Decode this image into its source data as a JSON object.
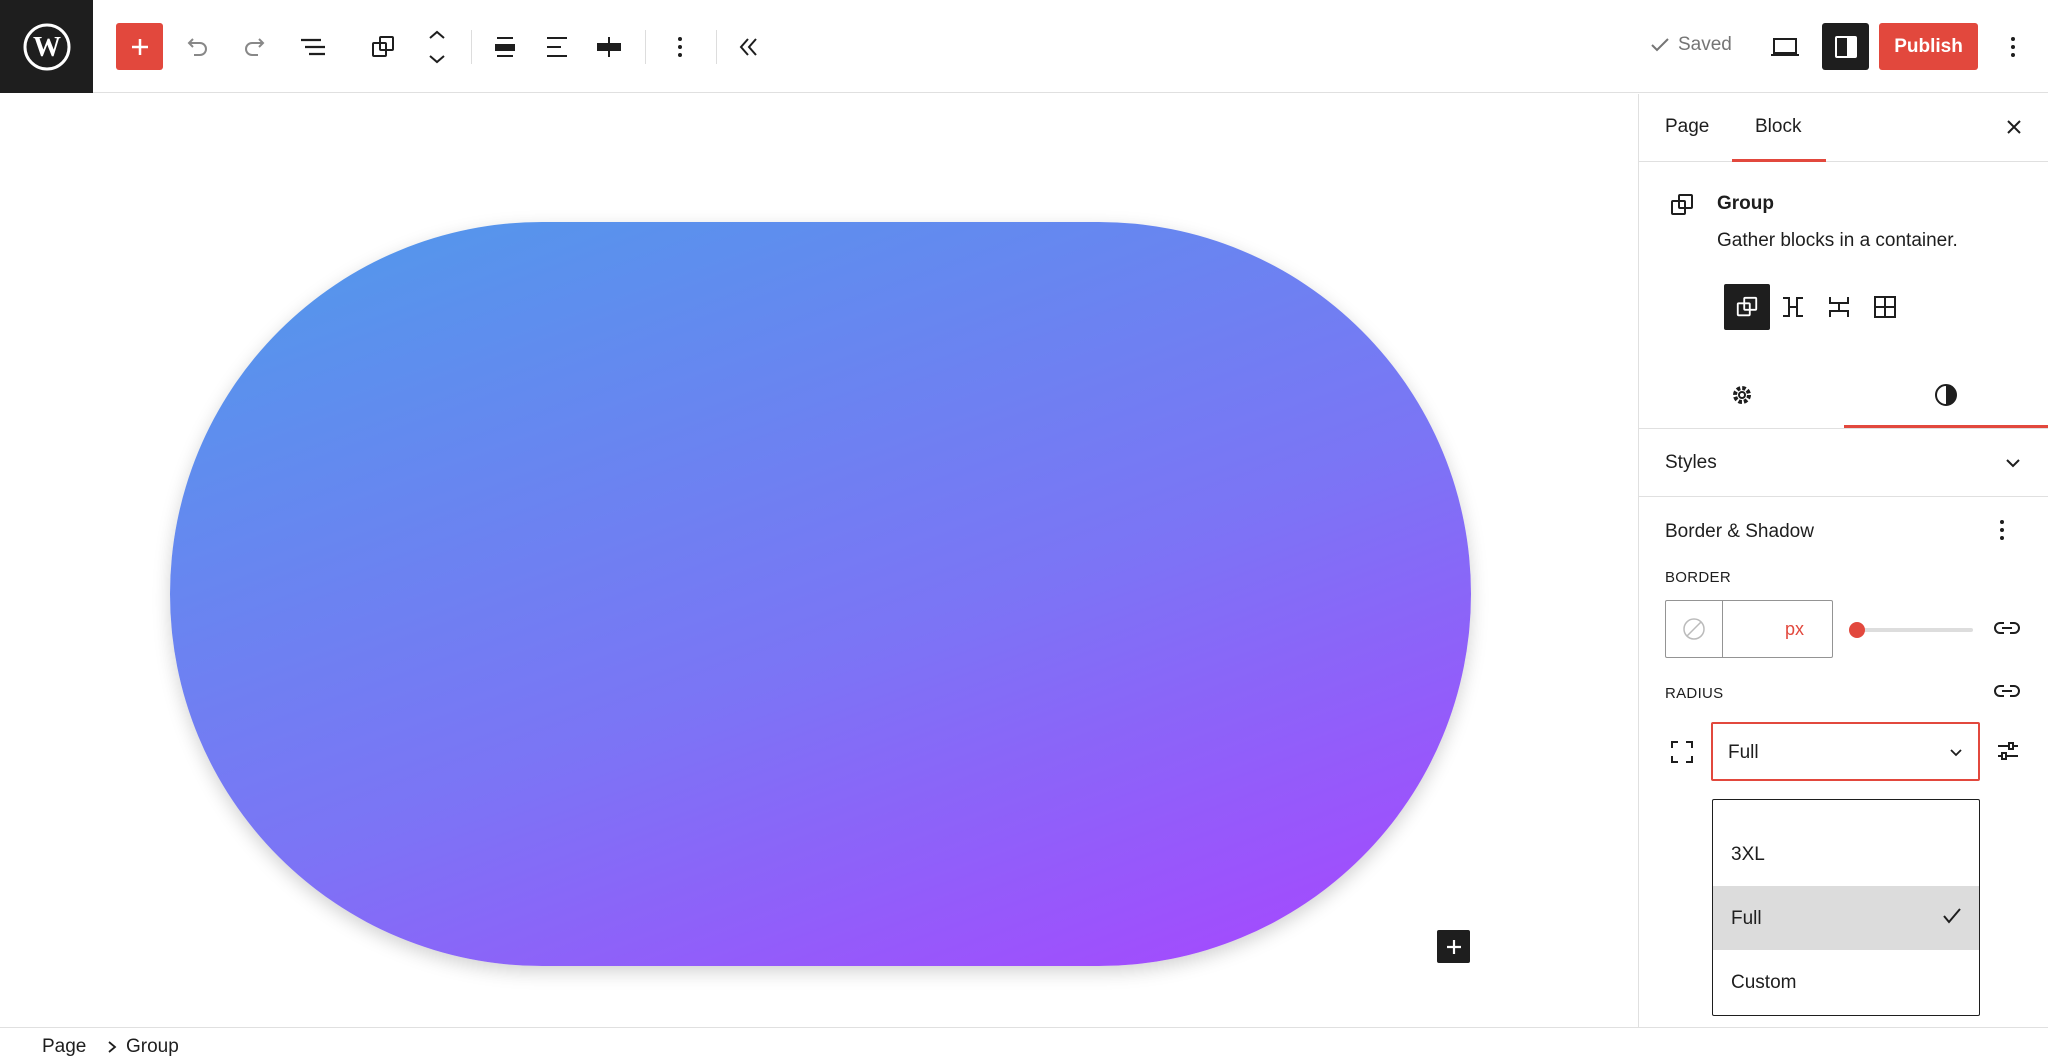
{
  "toolbar": {
    "saved_label": "Saved",
    "publish_label": "Publish"
  },
  "canvas": {
    "gradient_colors": [
      "#aa44ff",
      "#4f9bea"
    ]
  },
  "breadcrumb": {
    "items": [
      "Page",
      "Group"
    ]
  },
  "sidebar": {
    "tabs": [
      "Page",
      "Block"
    ],
    "active_tab": "Block",
    "block": {
      "title": "Group",
      "description": "Gather blocks in a container."
    },
    "styles_label": "Styles",
    "border_shadow_label": "Border & Shadow",
    "border_label": "BORDER",
    "border_unit": "px",
    "radius_label": "RADIUS",
    "radius_value": "Full",
    "radius_options": [
      "3XL",
      "Full",
      "Custom"
    ],
    "radius_selected": "Full"
  },
  "colors": {
    "accent": "#e2483d",
    "dark": "#1e1e1e"
  }
}
